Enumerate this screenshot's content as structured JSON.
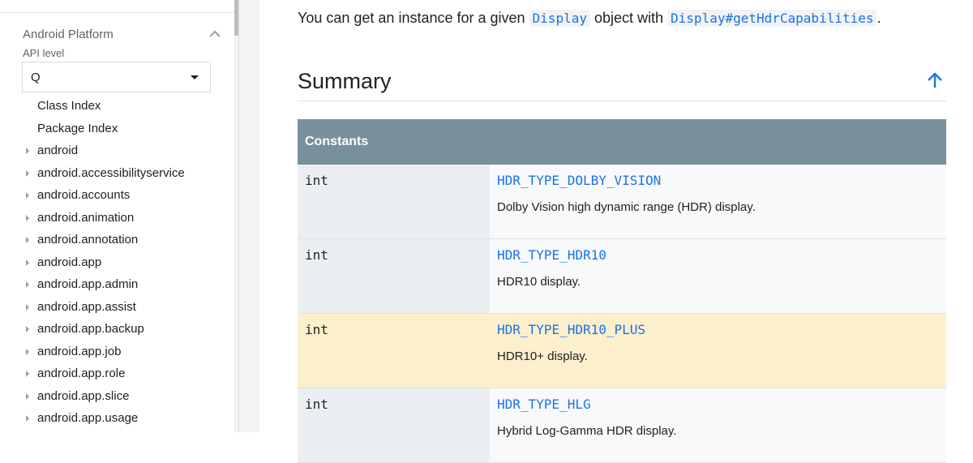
{
  "sidebar": {
    "title": "Android Platform",
    "api_level_label": "API level",
    "api_level_value": "Q",
    "items": [
      {
        "label": "Class Index",
        "expandable": false
      },
      {
        "label": "Package Index",
        "expandable": false
      },
      {
        "label": "android",
        "expandable": true
      },
      {
        "label": "android.accessibilityservice",
        "expandable": true
      },
      {
        "label": "android.accounts",
        "expandable": true
      },
      {
        "label": "android.animation",
        "expandable": true
      },
      {
        "label": "android.annotation",
        "expandable": true
      },
      {
        "label": "android.app",
        "expandable": true
      },
      {
        "label": "android.app.admin",
        "expandable": true
      },
      {
        "label": "android.app.assist",
        "expandable": true
      },
      {
        "label": "android.app.backup",
        "expandable": true
      },
      {
        "label": "android.app.job",
        "expandable": true
      },
      {
        "label": "android.app.role",
        "expandable": true
      },
      {
        "label": "android.app.slice",
        "expandable": true
      },
      {
        "label": "android.app.usage",
        "expandable": true
      }
    ]
  },
  "intro": {
    "prefix": "You can get an instance for a given ",
    "code1": "Display",
    "middle": " object with ",
    "code2": "Display#getHdrCapabilities",
    "suffix": "."
  },
  "summary": {
    "title": "Summary",
    "table_header": "Constants",
    "rows": [
      {
        "type": "int",
        "name": "HDR_TYPE_DOLBY_VISION",
        "desc": "Dolby Vision high dynamic range (HDR) display.",
        "highlight": false
      },
      {
        "type": "int",
        "name": "HDR_TYPE_HDR10",
        "desc": "HDR10 display.",
        "highlight": false
      },
      {
        "type": "int",
        "name": "HDR_TYPE_HDR10_PLUS",
        "desc": "HDR10+ display.",
        "highlight": true
      },
      {
        "type": "int",
        "name": "HDR_TYPE_HLG",
        "desc": "Hybrid Log-Gamma HDR display.",
        "highlight": false
      }
    ]
  },
  "colors": {
    "link": "#1a73e8",
    "table_header_bg": "#78909c",
    "highlight_row": "#fcefcc"
  },
  "icons": {
    "collapse": "chevron-up-icon",
    "dropdown": "caret-down-icon",
    "back_to_top": "arrow-up-icon",
    "tree_expand": "triangle-right-icon"
  }
}
